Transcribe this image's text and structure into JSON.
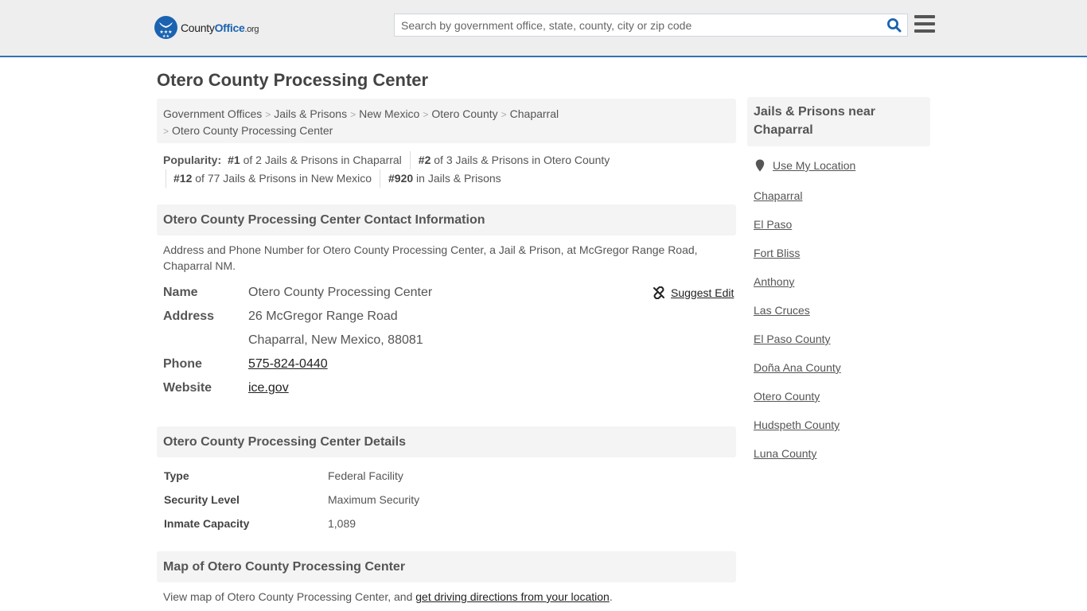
{
  "header": {
    "logo": {
      "part1": "County",
      "part2": "Office",
      "part3": ".org"
    },
    "search_placeholder": "Search by government office, state, county, city or zip code",
    "search_value": "",
    "brand_color": "#1b63b0",
    "accent_line_color": "#3173b0"
  },
  "page_title": "Otero County Processing Center",
  "breadcrumb": [
    {
      "label": "Government Offices"
    },
    {
      "label": "Jails & Prisons"
    },
    {
      "label": "New Mexico"
    },
    {
      "label": "Otero County"
    },
    {
      "label": "Chaparral"
    },
    {
      "label": "Otero County Processing Center"
    }
  ],
  "popularity": {
    "label": "Popularity:",
    "items": [
      {
        "rank": "#1",
        "text": " of 2 Jails & Prisons in Chaparral"
      },
      {
        "rank": "#2",
        "text": " of 3 Jails & Prisons in Otero County"
      },
      {
        "rank": "#12",
        "text": " of 77 Jails & Prisons in New Mexico"
      },
      {
        "rank": "#920",
        "text": " in Jails & Prisons"
      }
    ]
  },
  "contact": {
    "heading": "Otero County Processing Center Contact Information",
    "description": "Address and Phone Number for Otero County Processing Center, a Jail & Prison, at McGregor Range Road, Chaparral NM.",
    "suggest_edit": "Suggest Edit",
    "fields": {
      "name_label": "Name",
      "name_value": "Otero County Processing Center",
      "address_label": "Address",
      "address_line1": "26 McGregor Range Road",
      "address_line2": "Chaparral, New Mexico, 88081",
      "phone_label": "Phone",
      "phone_value": "575-824-0440",
      "website_label": "Website",
      "website_value": "ice.gov"
    }
  },
  "details": {
    "heading": "Otero County Processing Center Details",
    "rows": [
      {
        "label": "Type",
        "value": "Federal Facility"
      },
      {
        "label": "Security Level",
        "value": "Maximum Security"
      },
      {
        "label": "Inmate Capacity",
        "value": "1,089"
      }
    ]
  },
  "map": {
    "heading": "Map of Otero County Processing Center",
    "text_before": "View map of Otero County Processing Center, and ",
    "link": "get driving directions from your location",
    "text_after": "."
  },
  "sidebar": {
    "heading": "Jails & Prisons near Chaparral",
    "use_location": "Use My Location",
    "links": [
      "Chaparral",
      "El Paso",
      "Fort Bliss",
      "Anthony",
      "Las Cruces",
      "El Paso County",
      "Doña Ana County",
      "Otero County",
      "Hudspeth County",
      "Luna County"
    ]
  }
}
